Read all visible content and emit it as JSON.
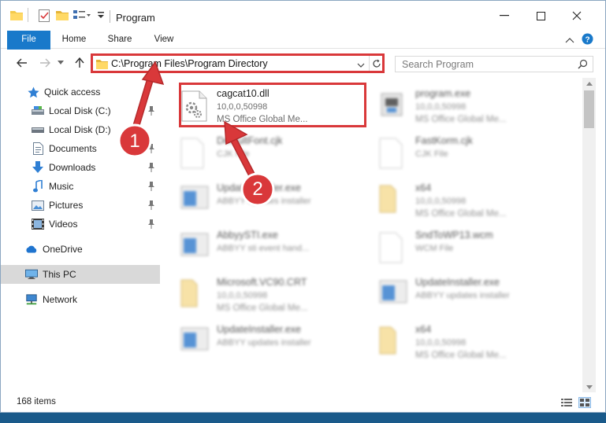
{
  "window": {
    "title": "Program",
    "controls": {
      "minimize": "—",
      "maximize": "☐",
      "close": "✕"
    }
  },
  "ribbon": {
    "tabs": [
      {
        "label": "File"
      },
      {
        "label": "Home"
      },
      {
        "label": "Share"
      },
      {
        "label": "View"
      }
    ]
  },
  "address": {
    "path": "C:\\Program Files\\Program Directory"
  },
  "search": {
    "placeholder": "Search Program"
  },
  "navigation": {
    "quick_access": "Quick access",
    "items": [
      {
        "label": "Local Disk (C:)",
        "icon": "drive-icon",
        "pinned": true
      },
      {
        "label": "Local Disk (D:)",
        "icon": "drive-icon",
        "pinned": false
      },
      {
        "label": "Documents",
        "icon": "documents-icon",
        "pinned": true
      },
      {
        "label": "Downloads",
        "icon": "downloads-icon",
        "pinned": true
      },
      {
        "label": "Music",
        "icon": "music-icon",
        "pinned": true
      },
      {
        "label": "Pictures",
        "icon": "pictures-icon",
        "pinned": true
      },
      {
        "label": "Videos",
        "icon": "videos-icon",
        "pinned": true
      }
    ],
    "onedrive": "OneDrive",
    "this_pc": "This PC",
    "network": "Network"
  },
  "files": {
    "left": [
      {
        "name": "cagcat10.dll",
        "line2": "10,0,0,50998",
        "line3": "MS Office Global Me...",
        "icon": "dll-icon",
        "highlighted": true
      },
      {
        "name": "DefaultFont.cjk",
        "line2": "CJK File",
        "line3": "",
        "icon": "generic-file-icon"
      },
      {
        "name": "UpdateInstaller.exe",
        "line2": "ABBYY updates installer",
        "line3": "",
        "icon": "exe-icon"
      },
      {
        "name": "AbbyySTI.exe",
        "line2": "ABBYY sti event hand...",
        "line3": "",
        "icon": "exe-icon"
      },
      {
        "name": "Microsoft.VC90.CRT",
        "line2": "10,0,0,50998",
        "line3": "MS Office Global Me...",
        "icon": "folder-icon"
      },
      {
        "name": "UpdateInstaller.exe",
        "line2": "ABBYY updates installer",
        "line3": "",
        "icon": "exe-icon"
      }
    ],
    "right": [
      {
        "name": "program.exe",
        "line2": "10,0,0,50998",
        "line3": "MS Office Global Me...",
        "icon": "program-icon"
      },
      {
        "name": "FastKorm.cjk",
        "line2": "CJK File",
        "line3": "",
        "icon": "generic-file-icon"
      },
      {
        "name": "x64",
        "line2": "10,0,0,50998",
        "line3": "MS Office Global Me...",
        "icon": "folder-icon"
      },
      {
        "name": "SndToWP13.wcm",
        "line2": "WCM File",
        "line3": "",
        "icon": "generic-file-icon"
      },
      {
        "name": "UpdateInstaller.exe",
        "line2": "ABBYY updates installer",
        "line3": "",
        "icon": "exe-icon"
      },
      {
        "name": "x64",
        "line2": "10,0,0,50998",
        "line3": "MS Office Global Me...",
        "icon": "folder-icon"
      }
    ]
  },
  "status": {
    "item_count": "168 items"
  },
  "annotations": {
    "step1": "1",
    "step2": "2",
    "color": "#d9383a"
  },
  "colors": {
    "accent": "#1979ca",
    "selection": "#cce8ff",
    "highlight": "#d9383a"
  }
}
